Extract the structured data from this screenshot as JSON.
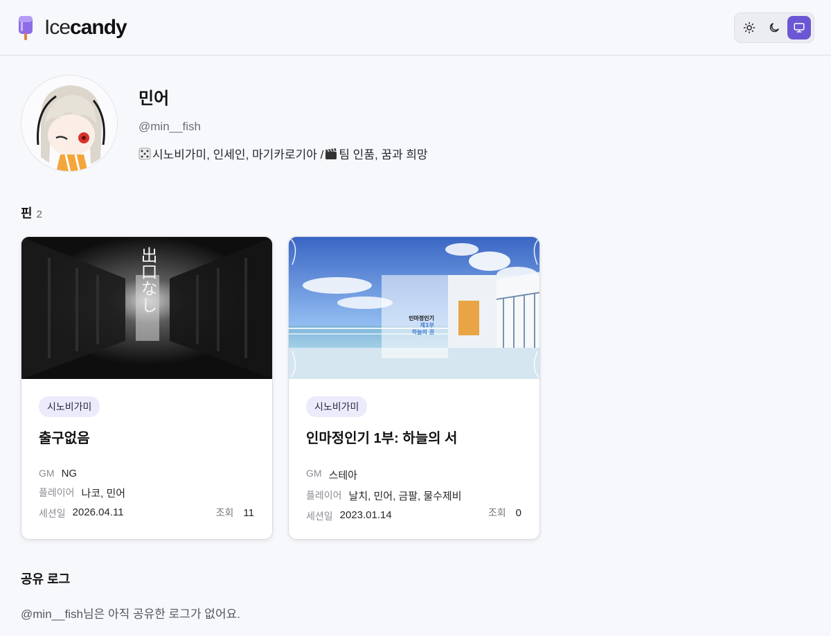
{
  "brand": {
    "name_light": "Ice",
    "name_bold": "candy",
    "logo_icon": "popsicle-icon"
  },
  "theme_toggle": {
    "options": [
      {
        "name": "light",
        "icon": "sun-icon",
        "active": false
      },
      {
        "name": "dark",
        "icon": "moon-icon",
        "active": false
      },
      {
        "name": "system",
        "icon": "monitor-icon",
        "active": true
      }
    ],
    "accent": "#6b57d3"
  },
  "profile": {
    "name": "민어",
    "handle": "@min__fish",
    "bio_part1": "시노비가미, 인세인, 마기카로기아 / ",
    "bio_part2": "팀 인품, 꿈과 희망"
  },
  "pins": {
    "title": "핀",
    "count": "2",
    "items": [
      {
        "tag": "시노비가미",
        "title": "출구없음",
        "image_text": "出口なし",
        "gm_label": "GM",
        "gm": "NG",
        "players_label": "플레이어",
        "players": "나코, 민어",
        "date_label": "세션일",
        "date": "2026.04.11",
        "views_label": "조회",
        "views": "11"
      },
      {
        "tag": "시노비가미",
        "title": "인마정인기 1부: 하늘의 서",
        "image_text_1": "인마정인기",
        "image_text_2": "제1부",
        "image_text_3": "하늘의 권",
        "gm_label": "GM",
        "gm": "스테아",
        "players_label": "플레이어",
        "players": "날치, 민어, 금팔, 물수제비",
        "date_label": "세션일",
        "date": "2023.01.14",
        "views_label": "조회",
        "views": "0"
      }
    ]
  },
  "logs": {
    "title": "공유 로그",
    "empty_message": "@min__fish님은 아직 공유한 로그가 없어요."
  }
}
